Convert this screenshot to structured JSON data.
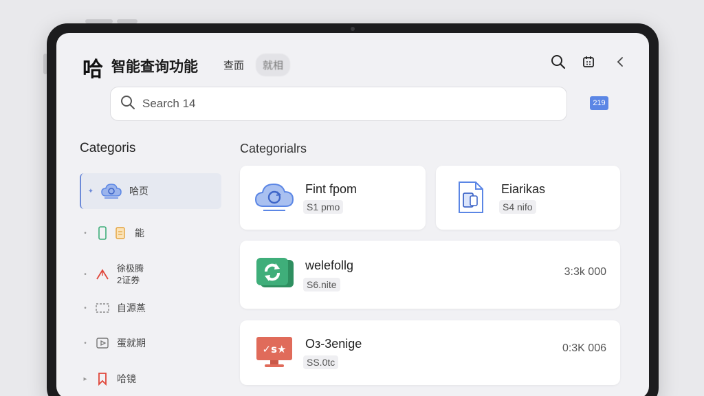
{
  "header": {
    "logo": "哈",
    "title": "智能查询功能",
    "tabs": [
      "查面",
      "就相"
    ]
  },
  "search": {
    "placeholder": "Search 14",
    "badge": "219"
  },
  "sidebar": {
    "heading": "Categoris",
    "items": [
      {
        "label": "哈页",
        "icon": "cloud-chat-icon",
        "active": true
      },
      {
        "label": "能",
        "icon": "phone-document-icon",
        "active": false
      },
      {
        "label": "徐极腾\n2证券",
        "icon": "chart-line-icon",
        "active": false
      },
      {
        "label": "自源蒸",
        "icon": "dashed-box-icon",
        "active": false
      },
      {
        "label": "蛋就期",
        "icon": "video-icon",
        "active": false
      },
      {
        "label": "哈镜",
        "icon": "bookmark-icon",
        "active": false
      }
    ]
  },
  "main": {
    "heading": "Categorialrs",
    "cards": [
      {
        "title": "Fint fpom",
        "tag": "S1 pmo",
        "amount": "",
        "icon": "cloud-refresh-icon",
        "color": "#5b86e5"
      },
      {
        "title": "Eiarikas",
        "tag": "S4 nifo",
        "amount": "",
        "icon": "document-device-icon",
        "color": "#5b86e5"
      },
      {
        "title": "welefollg",
        "tag": "S6.nite",
        "amount": "3:3k 000",
        "icon": "green-sync-icon",
        "color": "#3fae7a"
      },
      {
        "title": "Oз-3enige",
        "tag": "SS.0tc",
        "amount": "0:3K 006",
        "icon": "monitor-icon",
        "color": "#e06b5a"
      }
    ]
  },
  "colors": {
    "accent": "#5b86e5",
    "green": "#3fae7a",
    "red": "#e06b5a",
    "screen_bg": "#f1f1f4"
  }
}
